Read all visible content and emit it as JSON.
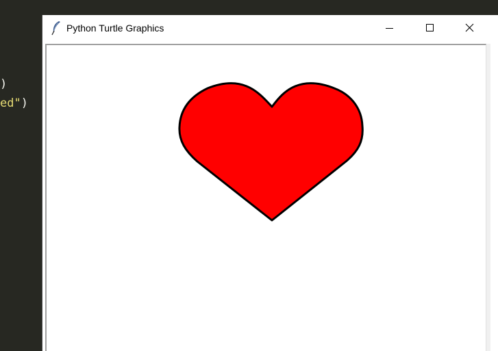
{
  "editor": {
    "code_lines": [
      {
        "string_part": "",
        "paren_part": ")"
      },
      {
        "string_part": "ed\"",
        "paren_part": ")"
      }
    ]
  },
  "window": {
    "title": "Python Turtle Graphics",
    "icon": "feather-icon",
    "controls": {
      "minimize_icon": "minimize-icon",
      "maximize_icon": "maximize-icon",
      "close_icon": "close-icon"
    }
  },
  "canvas": {
    "shape": "heart",
    "fill_color": "#ff0000",
    "outline_color": "#000000",
    "background_color": "#ffffff"
  }
}
